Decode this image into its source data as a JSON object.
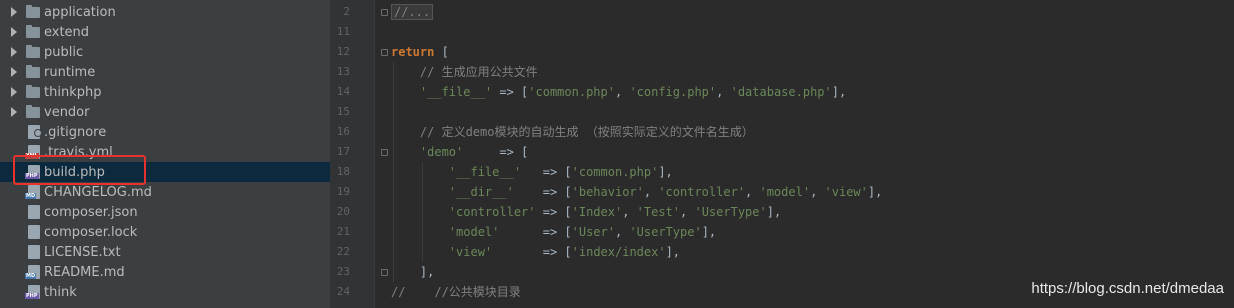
{
  "tree": {
    "items": [
      {
        "kind": "folder",
        "label": "application",
        "icon": "folder-icon"
      },
      {
        "kind": "folder",
        "label": "extend",
        "icon": "folder-icon"
      },
      {
        "kind": "folder",
        "label": "public",
        "icon": "folder-icon"
      },
      {
        "kind": "folder",
        "label": "runtime",
        "icon": "folder-icon"
      },
      {
        "kind": "folder",
        "label": "thinkphp",
        "icon": "folder-icon"
      },
      {
        "kind": "folder",
        "label": "vendor",
        "icon": "folder-icon"
      },
      {
        "kind": "file",
        "label": ".gitignore",
        "icon": "gitignore-file-icon",
        "tag": ""
      },
      {
        "kind": "file",
        "label": ".travis.yml",
        "icon": "yml-file-icon",
        "tag": "YML"
      },
      {
        "kind": "file",
        "label": "build.php",
        "icon": "php-file-icon",
        "tag": "PHP",
        "selected": true
      },
      {
        "kind": "file",
        "label": "CHANGELOG.md",
        "icon": "md-file-icon",
        "tag": "MD"
      },
      {
        "kind": "file",
        "label": "composer.json",
        "icon": "json-file-icon",
        "tag": ""
      },
      {
        "kind": "file",
        "label": "composer.lock",
        "icon": "lock-file-icon",
        "tag": ""
      },
      {
        "kind": "file",
        "label": "LICENSE.txt",
        "icon": "txt-file-icon",
        "tag": ""
      },
      {
        "kind": "file",
        "label": "README.md",
        "icon": "md-file-icon",
        "tag": "MD"
      },
      {
        "kind": "file",
        "label": "think",
        "icon": "php-file-icon",
        "tag": "PHP"
      }
    ]
  },
  "editor": {
    "lines": [
      {
        "no": "2",
        "fold": true,
        "guides": 0,
        "segments": [
          {
            "t": "//...",
            "c": "cmt",
            "box": true
          }
        ]
      },
      {
        "no": "11",
        "fold": false,
        "guides": 0,
        "segments": []
      },
      {
        "no": "12",
        "fold": true,
        "guides": 0,
        "segments": [
          {
            "t": "return",
            "c": "kw"
          },
          {
            "t": " [",
            "c": ""
          }
        ]
      },
      {
        "no": "13",
        "fold": false,
        "guides": 1,
        "segments": [
          {
            "t": "    // 生成应用公共文件",
            "c": "cmt"
          }
        ]
      },
      {
        "no": "14",
        "fold": false,
        "guides": 1,
        "segments": [
          {
            "t": "    ",
            "c": ""
          },
          {
            "t": "'__file__'",
            "c": "str"
          },
          {
            "t": " => [",
            "c": ""
          },
          {
            "t": "'common.php'",
            "c": "str"
          },
          {
            "t": ", ",
            "c": ""
          },
          {
            "t": "'config.php'",
            "c": "str"
          },
          {
            "t": ", ",
            "c": ""
          },
          {
            "t": "'database.php'",
            "c": "str"
          },
          {
            "t": "],",
            "c": ""
          }
        ]
      },
      {
        "no": "15",
        "fold": false,
        "guides": 1,
        "segments": []
      },
      {
        "no": "16",
        "fold": false,
        "guides": 1,
        "segments": [
          {
            "t": "    // 定义demo模块的自动生成 （按照实际定义的文件名生成）",
            "c": "cmt"
          }
        ]
      },
      {
        "no": "17",
        "fold": true,
        "guides": 1,
        "segments": [
          {
            "t": "    ",
            "c": ""
          },
          {
            "t": "'demo'",
            "c": "str"
          },
          {
            "t": "     => [",
            "c": ""
          }
        ]
      },
      {
        "no": "18",
        "fold": false,
        "guides": 2,
        "segments": [
          {
            "t": "        ",
            "c": ""
          },
          {
            "t": "'__file__'",
            "c": "str"
          },
          {
            "t": "   => [",
            "c": ""
          },
          {
            "t": "'common.php'",
            "c": "str"
          },
          {
            "t": "],",
            "c": ""
          }
        ]
      },
      {
        "no": "19",
        "fold": false,
        "guides": 2,
        "segments": [
          {
            "t": "        ",
            "c": ""
          },
          {
            "t": "'__dir__'",
            "c": "str"
          },
          {
            "t": "    => [",
            "c": ""
          },
          {
            "t": "'behavior'",
            "c": "str"
          },
          {
            "t": ", ",
            "c": ""
          },
          {
            "t": "'controller'",
            "c": "str"
          },
          {
            "t": ", ",
            "c": ""
          },
          {
            "t": "'model'",
            "c": "str"
          },
          {
            "t": ", ",
            "c": ""
          },
          {
            "t": "'view'",
            "c": "str"
          },
          {
            "t": "],",
            "c": ""
          }
        ]
      },
      {
        "no": "20",
        "fold": false,
        "guides": 2,
        "segments": [
          {
            "t": "        ",
            "c": ""
          },
          {
            "t": "'controller'",
            "c": "str"
          },
          {
            "t": " => [",
            "c": ""
          },
          {
            "t": "'Index'",
            "c": "str"
          },
          {
            "t": ", ",
            "c": ""
          },
          {
            "t": "'Test'",
            "c": "str"
          },
          {
            "t": ", ",
            "c": ""
          },
          {
            "t": "'UserType'",
            "c": "str"
          },
          {
            "t": "],",
            "c": ""
          }
        ]
      },
      {
        "no": "21",
        "fold": false,
        "guides": 2,
        "segments": [
          {
            "t": "        ",
            "c": ""
          },
          {
            "t": "'model'",
            "c": "str"
          },
          {
            "t": "      => [",
            "c": ""
          },
          {
            "t": "'User'",
            "c": "str"
          },
          {
            "t": ", ",
            "c": ""
          },
          {
            "t": "'UserType'",
            "c": "str"
          },
          {
            "t": "],",
            "c": ""
          }
        ]
      },
      {
        "no": "22",
        "fold": false,
        "guides": 2,
        "segments": [
          {
            "t": "        ",
            "c": ""
          },
          {
            "t": "'view'",
            "c": "str"
          },
          {
            "t": "       => [",
            "c": ""
          },
          {
            "t": "'index/index'",
            "c": "str"
          },
          {
            "t": "],",
            "c": ""
          }
        ]
      },
      {
        "no": "23",
        "fold": true,
        "guides": 1,
        "segments": [
          {
            "t": "    ],",
            "c": ""
          }
        ]
      },
      {
        "no": "24",
        "fold": false,
        "guides": 0,
        "segments": [
          {
            "t": "//    //公共模块目录",
            "c": "cmt"
          }
        ]
      }
    ]
  },
  "watermark": "https://blog.csdn.net/dmedaa",
  "colors": {
    "tree_bg": "#3c3f41",
    "editor_bg": "#2b2b2b",
    "selected_row": "#0d293e",
    "highlight_border": "#e8322d",
    "string": "#6a8759",
    "keyword": "#cc7832",
    "comment": "#808080"
  }
}
